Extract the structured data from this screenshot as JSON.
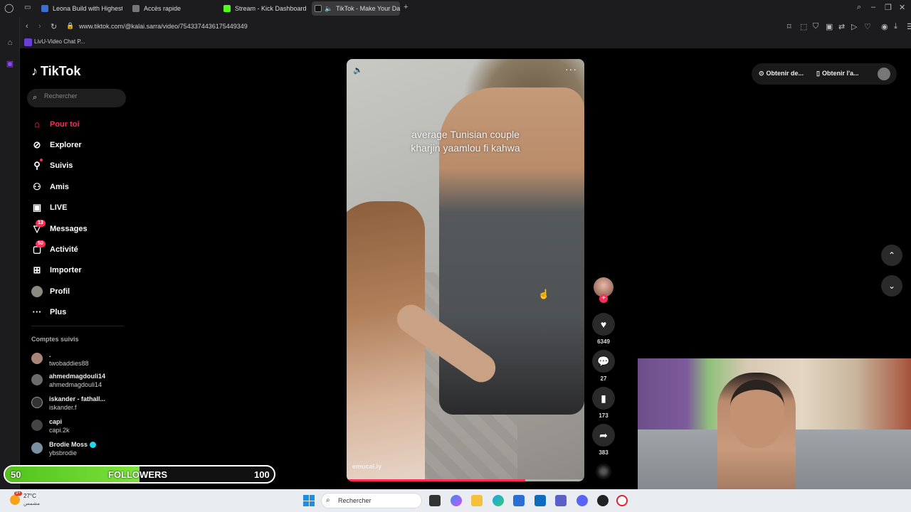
{
  "browser": {
    "tabs": [
      {
        "label": "Leona Build with Highest",
        "color": "#3b6fd1"
      },
      {
        "label": "Accès rapide",
        "color": "#777777"
      },
      {
        "label": "Stream - Kick Dashboard",
        "color": "#53fc18"
      },
      {
        "label": "TikTok - Make Your Da",
        "color": "#111111"
      }
    ],
    "url": "www.tiktok.com/@kalai.sarra/video/7543374436175449349",
    "bookmark": "LivU-Video Chat P..."
  },
  "sidebar": {
    "logo": "TikTok",
    "search_placeholder": "Rechercher",
    "nav": [
      {
        "label": "Pour toi",
        "icon": "home-icon"
      },
      {
        "label": "Explorer",
        "icon": "compass-icon"
      },
      {
        "label": "Suivis",
        "icon": "following-icon"
      },
      {
        "label": "Amis",
        "icon": "friends-icon"
      },
      {
        "label": "LIVE",
        "icon": "live-icon"
      },
      {
        "label": "Messages",
        "icon": "messages-icon",
        "badge": "13"
      },
      {
        "label": "Activité",
        "icon": "activity-icon",
        "badge": "50"
      },
      {
        "label": "Importer",
        "icon": "upload-icon"
      },
      {
        "label": "Profil",
        "icon": "profile-icon"
      },
      {
        "label": "Plus",
        "icon": "more-icon"
      }
    ],
    "following_title": "Comptes suivis",
    "following": [
      {
        "name": ".",
        "handle": "twobaddies88"
      },
      {
        "name": "ahmedmagdouli14",
        "handle": "ahmedmagdouli14"
      },
      {
        "name": "iskander - fathall...",
        "handle": "iskander.f"
      },
      {
        "name": "capi",
        "handle": "capi.2k"
      },
      {
        "name": "Brodie Moss",
        "handle": "ybsbrodie",
        "verified": true
      }
    ]
  },
  "video": {
    "caption_line1": "average Tunisian couple",
    "caption_line2": "kharjin yaamlou fi kahwa",
    "watermark": "emucal.ly",
    "progress": 0.75
  },
  "actions": {
    "likes": "6349",
    "comments": "27",
    "saves": "173",
    "shares": "383"
  },
  "topbar": {
    "get_coins": "Obtenir de...",
    "get_app": "Obtenir l'a..."
  },
  "overlay": {
    "followers_current": "50",
    "followers_label": "FOLLOWERS",
    "followers_goal": "100",
    "followers_progress": 0.5
  },
  "taskbar": {
    "temp": "27°C",
    "condition": "مشمس",
    "weather_badge": "9+",
    "search": "Rechercher"
  }
}
